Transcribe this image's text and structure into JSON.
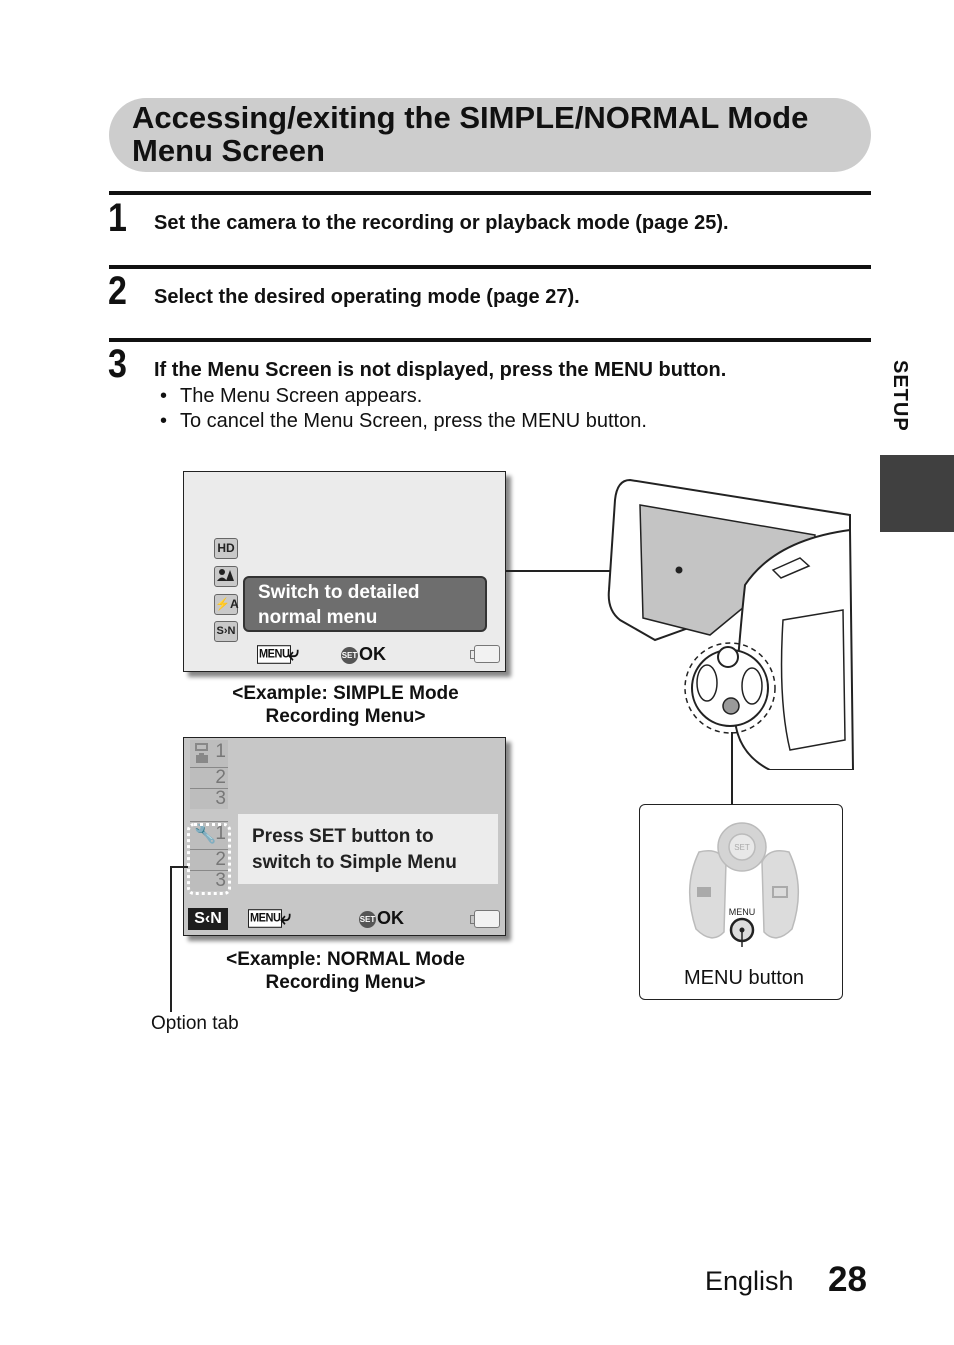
{
  "header": {
    "title_line1": "Accessing/exiting the SIMPLE/NORMAL Mode",
    "title_line2": "Menu Screen"
  },
  "steps": [
    {
      "number": "1",
      "text": "Set the camera to the recording or playback mode (page 25).",
      "bullets": []
    },
    {
      "number": "2",
      "text": "Select the desired operating mode (page 27).",
      "bullets": []
    },
    {
      "number": "3",
      "text": "If the Menu Screen is not displayed, press the MENU button.",
      "bullets": [
        "The Menu Screen appears.",
        "To cancel the Menu Screen, press the MENU button."
      ]
    }
  ],
  "side_tab": {
    "label": "SETUP"
  },
  "simple_menu": {
    "icons": [
      {
        "name": "hd-icon",
        "label": "HD"
      },
      {
        "name": "scene-icon",
        "label": "▲▲"
      },
      {
        "name": "flash-auto-icon",
        "label": "⚡A"
      },
      {
        "name": "simple-normal-icon",
        "label": "S›N"
      }
    ],
    "balloon_line1": "Switch to detailed",
    "balloon_line2": "normal menu",
    "menu_badge": "MENU",
    "return_icon": "⤶",
    "set_label": "SET",
    "ok_label": "OK",
    "caption_line1": "<Example: SIMPLE Mode",
    "caption_line2": "Recording Menu>"
  },
  "normal_menu": {
    "record_tabs": [
      "1",
      "2",
      "3"
    ],
    "option_tabs": [
      "1",
      "2",
      "3"
    ],
    "info_line1": "Press SET button to",
    "info_line2": "switch to Simple Menu",
    "sn_badge": "S‹N",
    "menu_badge": "MENU",
    "return_icon": "⤶",
    "set_label": "SET",
    "ok_label": "OK",
    "caption_line1": "<Example: NORMAL Mode",
    "caption_line2": "Recording Menu>"
  },
  "callouts": {
    "option_tab": "Option tab",
    "menu_button": "MENU button"
  },
  "inset": {
    "set_label": "SET",
    "menu_label": "MENU"
  },
  "footer": {
    "language": "English",
    "page_number": "28"
  }
}
